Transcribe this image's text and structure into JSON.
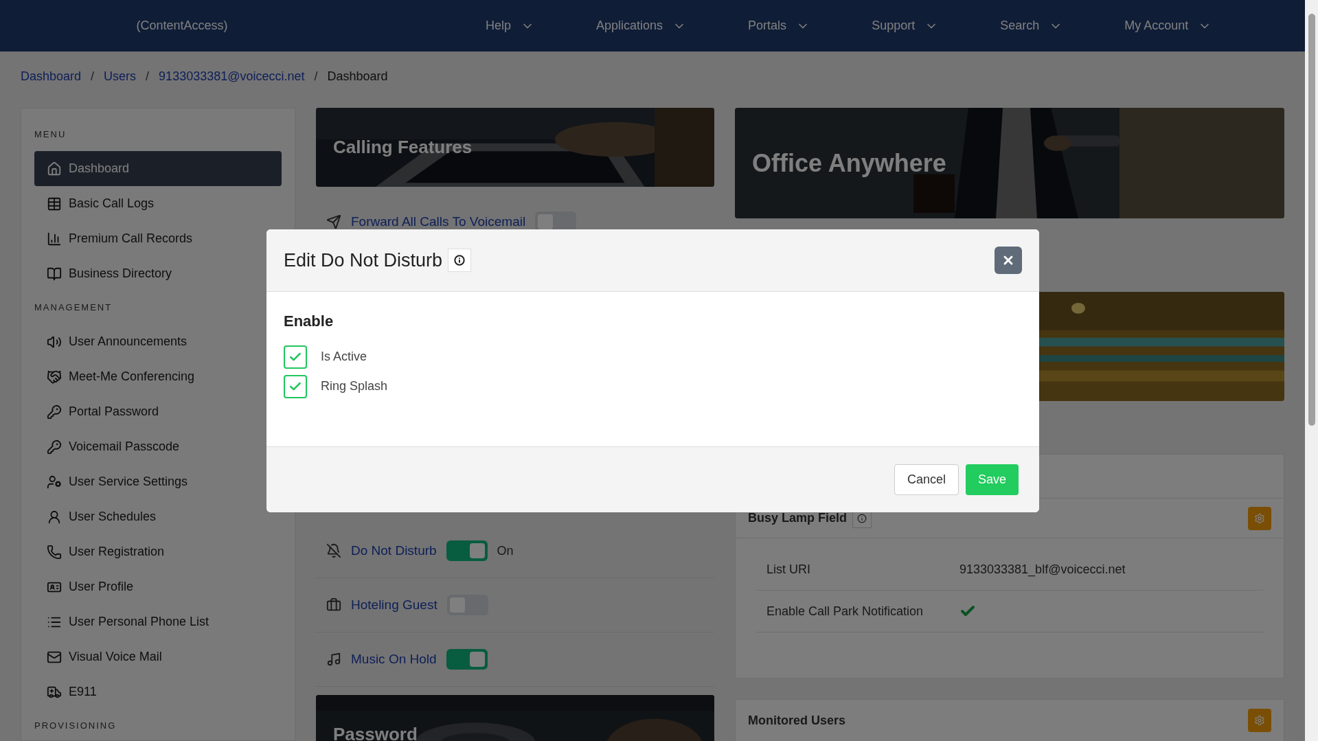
{
  "nav": {
    "brand": "(ContentAccess)",
    "menus": [
      "Help",
      "Applications",
      "Portals",
      "Support",
      "Search",
      "My Account"
    ]
  },
  "breadcrumb": [
    {
      "label": "Dashboard",
      "link": true
    },
    {
      "separator": "/",
      "label": "Users",
      "link": true
    },
    {
      "separator": "/",
      "label": "9133033381@voicecci.net",
      "link": true
    },
    {
      "separator": "/",
      "label": "Dashboard",
      "link": false
    }
  ],
  "sidebar": {
    "sections": [
      {
        "heading": "MENU",
        "items": [
          {
            "label": "Dashboard",
            "selected": true
          },
          {
            "label": "Basic Call Logs",
            "selected": false
          },
          {
            "label": "Premium Call Records",
            "selected": false
          },
          {
            "label": "Business Directory",
            "selected": false
          }
        ]
      },
      {
        "heading": "MANAGEMENT",
        "items": [
          {
            "label": "User Announcements",
            "selected": false
          },
          {
            "label": "Meet-Me Conferencing",
            "selected": false
          },
          {
            "label": "Portal Password",
            "selected": false
          },
          {
            "label": "Voicemail Passcode",
            "selected": false
          },
          {
            "label": "User Service Settings",
            "selected": false
          },
          {
            "label": "User Schedules",
            "selected": false
          },
          {
            "label": "User Registration",
            "selected": false
          },
          {
            "label": "User Profile",
            "selected": false
          },
          {
            "label": "User Personal Phone List",
            "selected": false
          },
          {
            "label": "Visual Voice Mail",
            "selected": false
          },
          {
            "label": "E911",
            "selected": false
          }
        ]
      },
      {
        "heading": "PROVISIONING"
      }
    ]
  },
  "calling_features": {
    "banner": "Calling Features",
    "top_features": [
      {
        "label": "Forward All Calls To Voicemail",
        "on": false
      }
    ],
    "features": [
      {
        "label": "Do Not Disturb",
        "on": true,
        "state_text": "On"
      },
      {
        "label": "Hoteling Guest",
        "on": false
      },
      {
        "label": "Music On Hold",
        "on": true
      }
    ],
    "password_banner": "Password"
  },
  "office_anywhere": {
    "banner": "Office Anywhere"
  },
  "busy_lamp_field": {
    "title": "Busy Lamp Field",
    "rows": [
      {
        "label": "List URI",
        "kind": "text",
        "value": "9133033381_blf@voicecci.net"
      },
      {
        "label": "Enable Call Park Notification",
        "kind": "check",
        "checked": true
      }
    ]
  },
  "monitored_users": {
    "title": "Monitored Users"
  },
  "modal": {
    "title": "Edit Do Not Disturb",
    "section": "Enable",
    "options": [
      {
        "label": "Is Active",
        "checked": true
      },
      {
        "label": "Ring Splash",
        "checked": true
      }
    ],
    "buttons": [
      {
        "label": "Cancel",
        "kind": "secondary"
      },
      {
        "label": "Save",
        "kind": "primary"
      }
    ]
  }
}
